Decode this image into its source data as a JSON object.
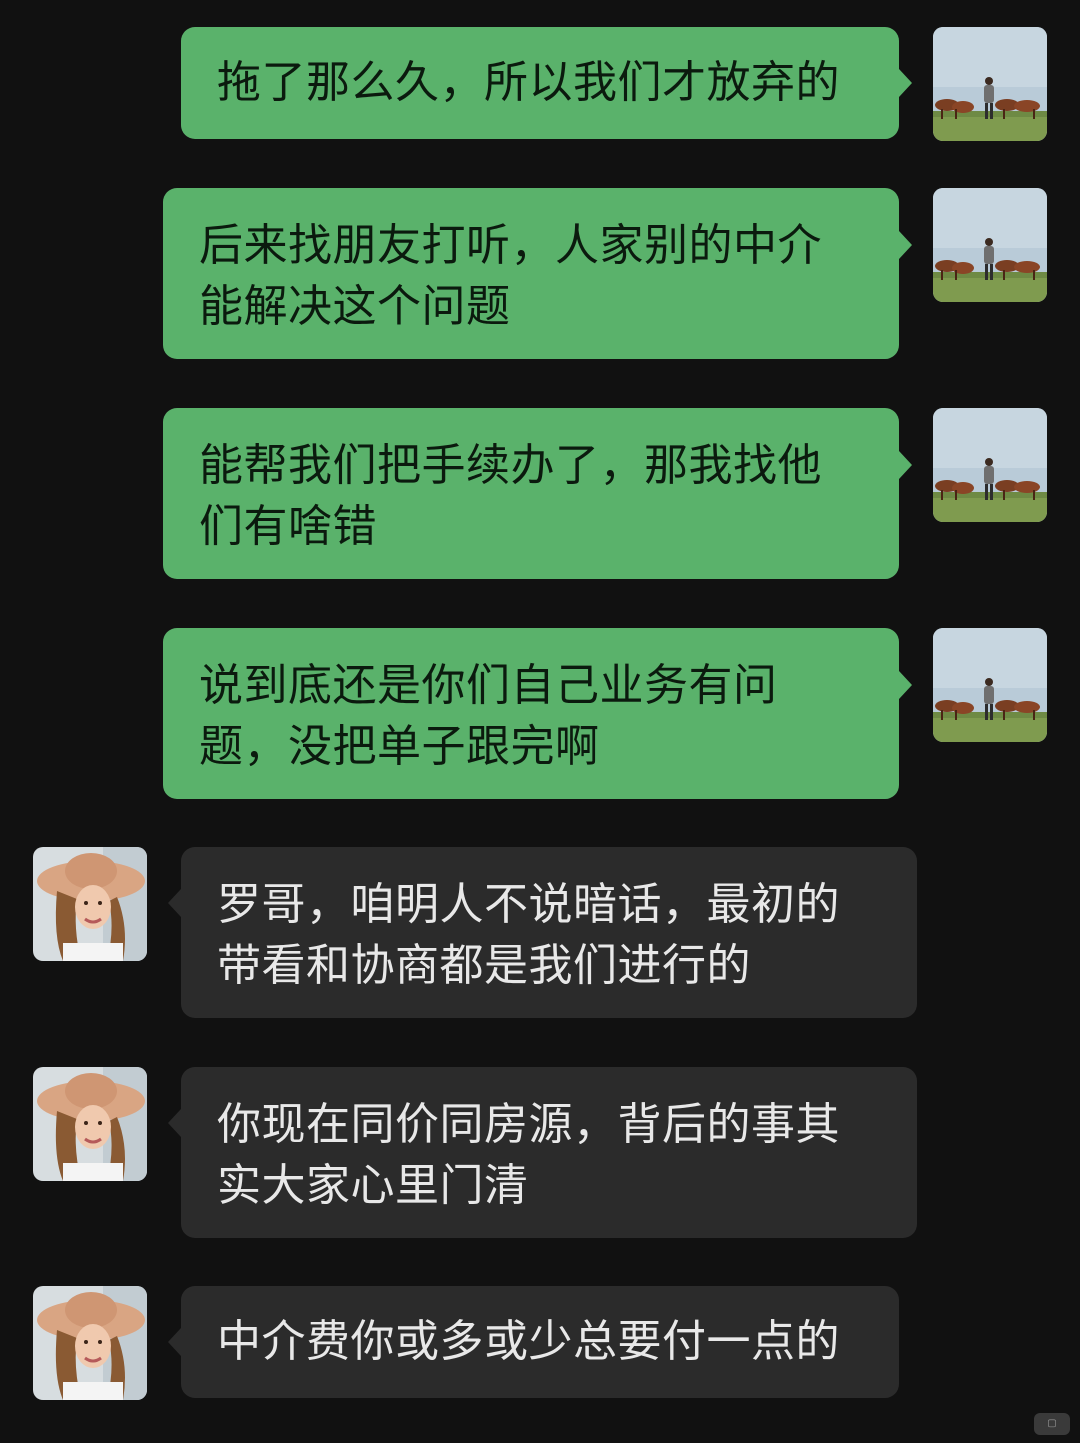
{
  "messages": [
    {
      "side": "out",
      "text": "拖了那么久，所以我们才放弃的"
    },
    {
      "side": "out",
      "text": "后来找朋友打听，人家别的中介能解决这个问题"
    },
    {
      "side": "out",
      "text": "能帮我们把手续办了，那我找他们有啥错"
    },
    {
      "side": "out",
      "text": "说到底还是你们自己业务有问题，没把单子跟完啊"
    },
    {
      "side": "in",
      "text": "罗哥，咱明人不说暗话，最初的带看和协商都是我们进行的"
    },
    {
      "side": "in",
      "text": "你现在同价同房源，背后的事其实大家心里门清"
    },
    {
      "side": "in",
      "text": "中介费你或多或少总要付一点的"
    }
  ],
  "colors": {
    "background": "#111111",
    "outgoing_bubble": "#5ab26b",
    "incoming_bubble": "#2b2b2b"
  },
  "icons": {
    "self_avatar": "man-with-horses-avatar",
    "other_avatar": "woman-in-sunhat-avatar"
  }
}
